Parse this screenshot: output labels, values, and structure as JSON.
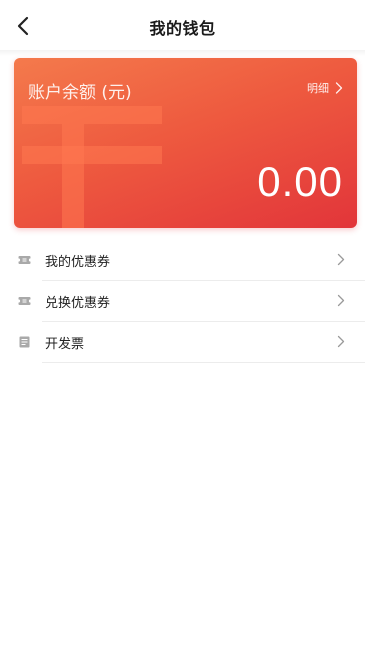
{
  "header": {
    "title": "我的钱包",
    "back_icon": "chevron-left-icon"
  },
  "wallet": {
    "balance_label": "账户余额 (元)",
    "detail_label": "明细",
    "amount": "0.00",
    "gradient_colors": [
      "#f47a4c",
      "#ee5a3f",
      "#e2353a"
    ]
  },
  "menu": {
    "items": [
      {
        "label": "我的优惠券",
        "icon": "coupon-icon"
      },
      {
        "label": "兑换优惠券",
        "icon": "coupon-exchange-icon"
      },
      {
        "label": "开发票",
        "icon": "invoice-icon"
      }
    ]
  }
}
